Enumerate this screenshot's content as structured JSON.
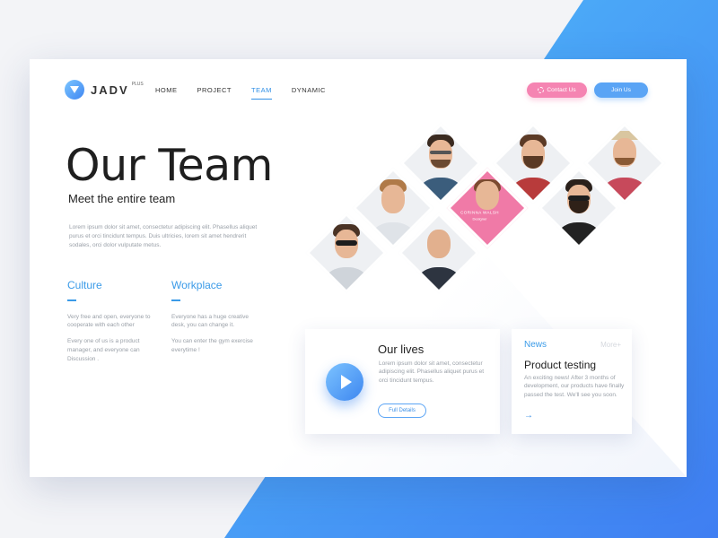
{
  "brand": {
    "name": "JADV",
    "sup": "PLUS"
  },
  "nav": {
    "items": [
      "HOME",
      "PROJECT",
      "TEAM",
      "DYNAMIC"
    ],
    "active": "TEAM"
  },
  "header": {
    "contact_label": "Contact Us",
    "join_label": "Join Us"
  },
  "hero": {
    "title": "Our Team",
    "subtitle": "Meet the entire team",
    "description": "Lorem ipsum dolor sit amet, consectetur adipiscing elit. Phasellus aliquet purus et orci tincidunt tempus. Duis ultricies, lorem sit amet hendrerit sodales, orci dolor vulputate metus."
  },
  "culture": {
    "title": "Culture",
    "p1": "Very free and open, everyone to cooperate with each other",
    "p2": "Every one of us is a product manager, and everyone can Discussion ."
  },
  "workplace": {
    "title": "Workplace",
    "p1": "Everyone has a huge creative desk, you can change it.",
    "p2": "You can enter the gym exercise everytime !"
  },
  "team": {
    "featured": {
      "name": "CORINNA WALSH",
      "role": "Designer"
    }
  },
  "lives": {
    "title": "Our lives",
    "text": "Lorem ipsum dolor sit amet, consectetur adipiscing elit. Phasellus aliquet purus et orci tincidunt tempus.",
    "button": "Full Details"
  },
  "news": {
    "label": "News",
    "more": "More+",
    "title": "Product testing",
    "text": "An exciting news! After 3 months of development, our products have finally passed the test. We'll see you soon.",
    "arrow": "→"
  },
  "colors": {
    "accent": "#3b9be8",
    "pink": "#f584b2",
    "blue": "#5aa4f5"
  }
}
